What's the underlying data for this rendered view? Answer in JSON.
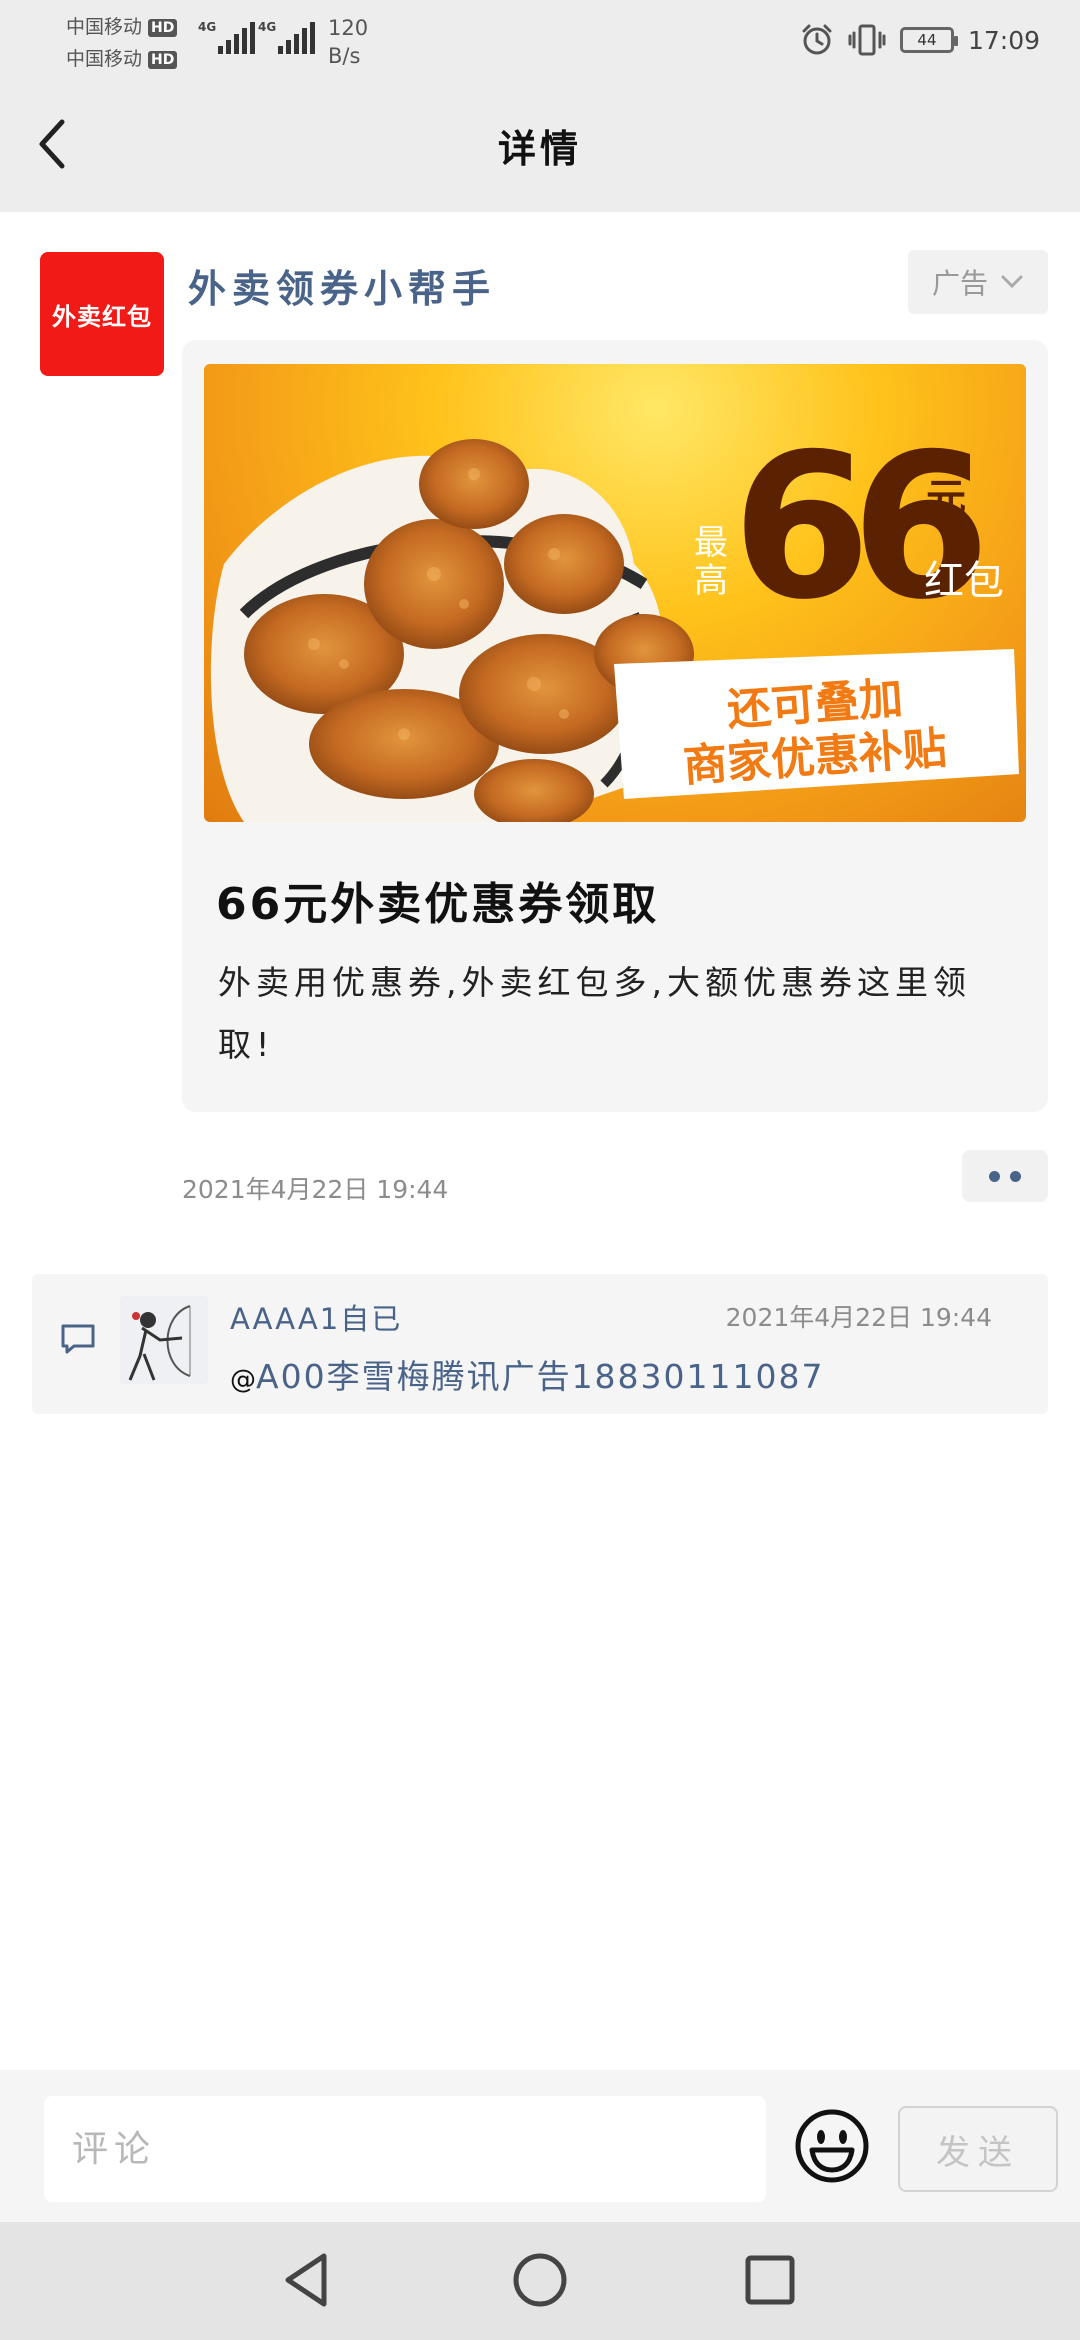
{
  "status_bar": {
    "carrier_1": "中国移动",
    "carrier_2": "中国移动",
    "hd_label": "HD",
    "network_type": "4G",
    "net_speed_value": "120",
    "net_speed_unit": "B/s",
    "battery_level": "44",
    "time": "17:09",
    "icons": [
      "alarm-icon",
      "vibrate-icon",
      "battery-icon"
    ]
  },
  "header": {
    "title": "详情",
    "back_icon": "chevron-left-icon"
  },
  "post": {
    "avatar_text": "外卖红包",
    "author": "外卖领券小帮手",
    "ad_label": "广告",
    "banner": {
      "highlight_prefix_1": "最",
      "highlight_prefix_2": "高",
      "highlight_amount": "66",
      "highlight_unit": "元",
      "highlight_suffix": "红包",
      "stamp_line_1": "还可叠加",
      "stamp_line_2": "商家优惠补贴"
    },
    "card_title": "66元外卖优惠券领取",
    "card_desc": "外卖用优惠券,外卖红包多,大额优惠券这里领取!",
    "time": "2021年4月22日  19:44",
    "more_icon": "more-dots-icon"
  },
  "comment": {
    "icon": "comment-icon",
    "user": "AAAA1自已",
    "time": "2021年4月22日  19:44",
    "at_symbol": "@",
    "text": "A00李雪梅腾讯广告18830111087"
  },
  "input_bar": {
    "placeholder": "评论",
    "emoji_icon": "smiley-icon",
    "send_label": "发送"
  },
  "system_nav": {
    "icons": [
      "back-triangle-icon",
      "home-circle-icon",
      "recents-square-icon"
    ]
  },
  "colors": {
    "link_blue": "#4a6389",
    "ad_red": "#f11a17",
    "bar_gray": "#ededed"
  }
}
